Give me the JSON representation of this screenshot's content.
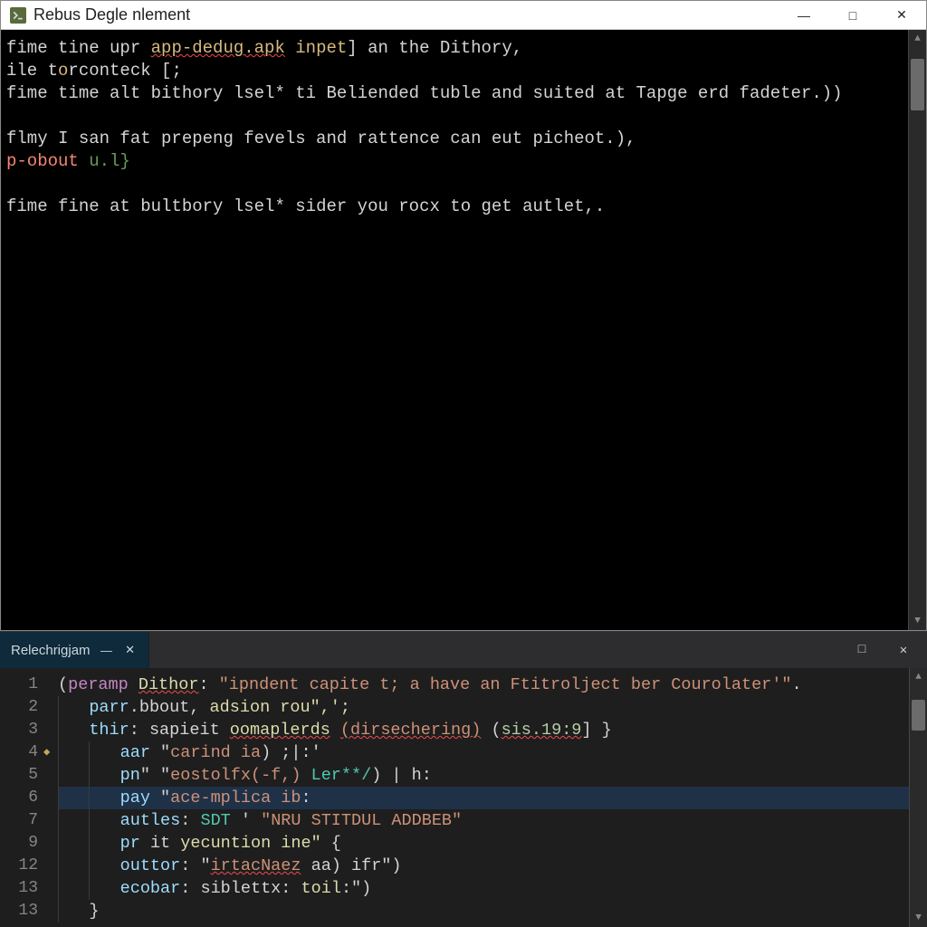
{
  "top_window": {
    "title": "Rebus Degle nlement",
    "icon_name": "terminal-app-icon",
    "controls": {
      "min": "—",
      "max": "□",
      "close": "✕"
    },
    "scrollbar": {
      "thumb_top_pct": 2,
      "thumb_height_pct": 9
    },
    "lines": [
      {
        "spans": [
          {
            "t": "fime tine upr ",
            "c": "t-white"
          },
          {
            "t": "app-dedug.apk",
            "c": "t-yellow t-underline"
          },
          {
            "t": " inpet",
            "c": "t-yellow"
          },
          {
            "t": "] an the Dithory,",
            "c": "t-white"
          }
        ]
      },
      {
        "spans": [
          {
            "t": "ile t",
            "c": "t-white"
          },
          {
            "t": "o",
            "c": "t-yellow"
          },
          {
            "t": "rconteck [;",
            "c": "t-white"
          }
        ]
      },
      {
        "spans": [
          {
            "t": "fime time alt bithory lsel",
            "c": "t-white"
          },
          {
            "t": "*",
            "c": "t-white"
          },
          {
            "t": " ti Beliended tuble and suited at Tapge erd fadeter.))",
            "c": "t-white"
          }
        ]
      },
      {
        "spans": [
          {
            "t": " ",
            "c": "t-white"
          }
        ]
      },
      {
        "spans": [
          {
            "t": "flmy I san fat prepeng fevels and rattence can eut picheot.),",
            "c": "t-white"
          }
        ]
      },
      {
        "spans": [
          {
            "t": "p-obout ",
            "c": "t-red"
          },
          {
            "t": "u.l}",
            "c": "t-green"
          }
        ]
      },
      {
        "spans": [
          {
            "t": " ",
            "c": "t-white"
          }
        ]
      },
      {
        "spans": [
          {
            "t": "fime fine at bultbory lsel",
            "c": "t-white"
          },
          {
            "t": "*",
            "c": "t-white"
          },
          {
            "t": " sider you rocx to get autlet,.",
            "c": "t-white"
          }
        ]
      }
    ]
  },
  "bottom_window": {
    "tab": {
      "label": "Relechrigjam",
      "min": "—",
      "close": "✕"
    },
    "controls": {
      "max": "□",
      "close": "✕"
    },
    "scrollbar": {
      "thumb_top_pct": 6,
      "thumb_height_pct": 14
    },
    "gutter_numbers": [
      "1",
      "2",
      "3",
      "4",
      "5",
      "6",
      "7",
      "9",
      "12",
      "13",
      "13"
    ],
    "gutter_icon_row": 3,
    "highlight_row": 5,
    "lines": [
      {
        "spans": [
          {
            "t": "(",
            "c": "c-punct"
          },
          {
            "t": "peramp",
            "c": "c-kw"
          },
          {
            "t": " ",
            "c": "c-default"
          },
          {
            "t": "Dithor",
            "c": "c-ident c-err"
          },
          {
            "t": ": ",
            "c": "c-punct"
          },
          {
            "t": "\"ipndent capite t; a have an Ftitrolject ber Courolater'\"",
            "c": "c-string"
          },
          {
            "t": ".",
            "c": "c-punct"
          }
        ]
      },
      {
        "indent": 1,
        "spans": [
          {
            "t": "parr",
            "c": "c-key"
          },
          {
            "t": ".bbout,",
            "c": "c-default"
          },
          {
            "t": " adsion rou\",';",
            "c": "c-ident"
          }
        ]
      },
      {
        "indent": 1,
        "spans": [
          {
            "t": "thir",
            "c": "c-key"
          },
          {
            "t": ": ",
            "c": "c-punct"
          },
          {
            "t": "sapieit",
            "c": "c-default"
          },
          {
            "t": " ",
            "c": "c-default"
          },
          {
            "t": "oomaplerds",
            "c": "c-ident c-err"
          },
          {
            "t": " ",
            "c": "c-default"
          },
          {
            "t": "(dirsechering)",
            "c": "c-string c-err"
          },
          {
            "t": " (",
            "c": "c-punct"
          },
          {
            "t": "sis.19:9",
            "c": "c-num c-err"
          },
          {
            "t": "] }",
            "c": "c-punct"
          }
        ]
      },
      {
        "indent": 2,
        "spans": [
          {
            "t": "aar",
            "c": "c-key"
          },
          {
            "t": " \"",
            "c": "c-punct"
          },
          {
            "t": "carind ia",
            "c": "c-string"
          },
          {
            "t": ") ;|:'",
            "c": "c-punct"
          }
        ]
      },
      {
        "indent": 2,
        "spans": [
          {
            "t": "pn",
            "c": "c-key"
          },
          {
            "t": "\" \"",
            "c": "c-punct"
          },
          {
            "t": "eostolfx(-f,)",
            "c": "c-string"
          },
          {
            "t": " ",
            "c": "c-default"
          },
          {
            "t": "Ler**/",
            "c": "c-type"
          },
          {
            "t": ") | h:",
            "c": "c-punct"
          }
        ]
      },
      {
        "indent": 2,
        "spans": [
          {
            "t": "pay",
            "c": "c-key"
          },
          {
            "t": " \"",
            "c": "c-punct"
          },
          {
            "t": "ace-mplica ib",
            "c": "c-string"
          },
          {
            "t": ":",
            "c": "c-punct"
          }
        ]
      },
      {
        "indent": 2,
        "spans": [
          {
            "t": "autles",
            "c": "c-key"
          },
          {
            "t": ": ",
            "c": "c-punct"
          },
          {
            "t": "SDT",
            "c": "c-type"
          },
          {
            "t": " ' ",
            "c": "c-punct"
          },
          {
            "t": "\"NRU STITDUL ADDBEB\"",
            "c": "c-string"
          }
        ]
      },
      {
        "indent": 2,
        "spans": [
          {
            "t": "pr",
            "c": "c-key"
          },
          {
            "t": " it ",
            "c": "c-default"
          },
          {
            "t": "yecuntion ine\"",
            "c": "c-ident"
          },
          {
            "t": " {",
            "c": "c-punct"
          }
        ]
      },
      {
        "indent": 2,
        "spans": [
          {
            "t": "outtor",
            "c": "c-key"
          },
          {
            "t": ": \"",
            "c": "c-punct"
          },
          {
            "t": "irtacNaez",
            "c": "c-string c-err"
          },
          {
            "t": " aa) ifr\")",
            "c": "c-punct"
          }
        ]
      },
      {
        "indent": 2,
        "spans": [
          {
            "t": "ecobar",
            "c": "c-key"
          },
          {
            "t": ": ",
            "c": "c-punct"
          },
          {
            "t": "siblettx",
            "c": "c-default"
          },
          {
            "t": ": ",
            "c": "c-punct"
          },
          {
            "t": "toil",
            "c": "c-ident"
          },
          {
            "t": ":\")",
            "c": "c-punct"
          }
        ]
      },
      {
        "indent": 1,
        "spans": [
          {
            "t": "}",
            "c": "c-punct"
          }
        ]
      }
    ]
  }
}
